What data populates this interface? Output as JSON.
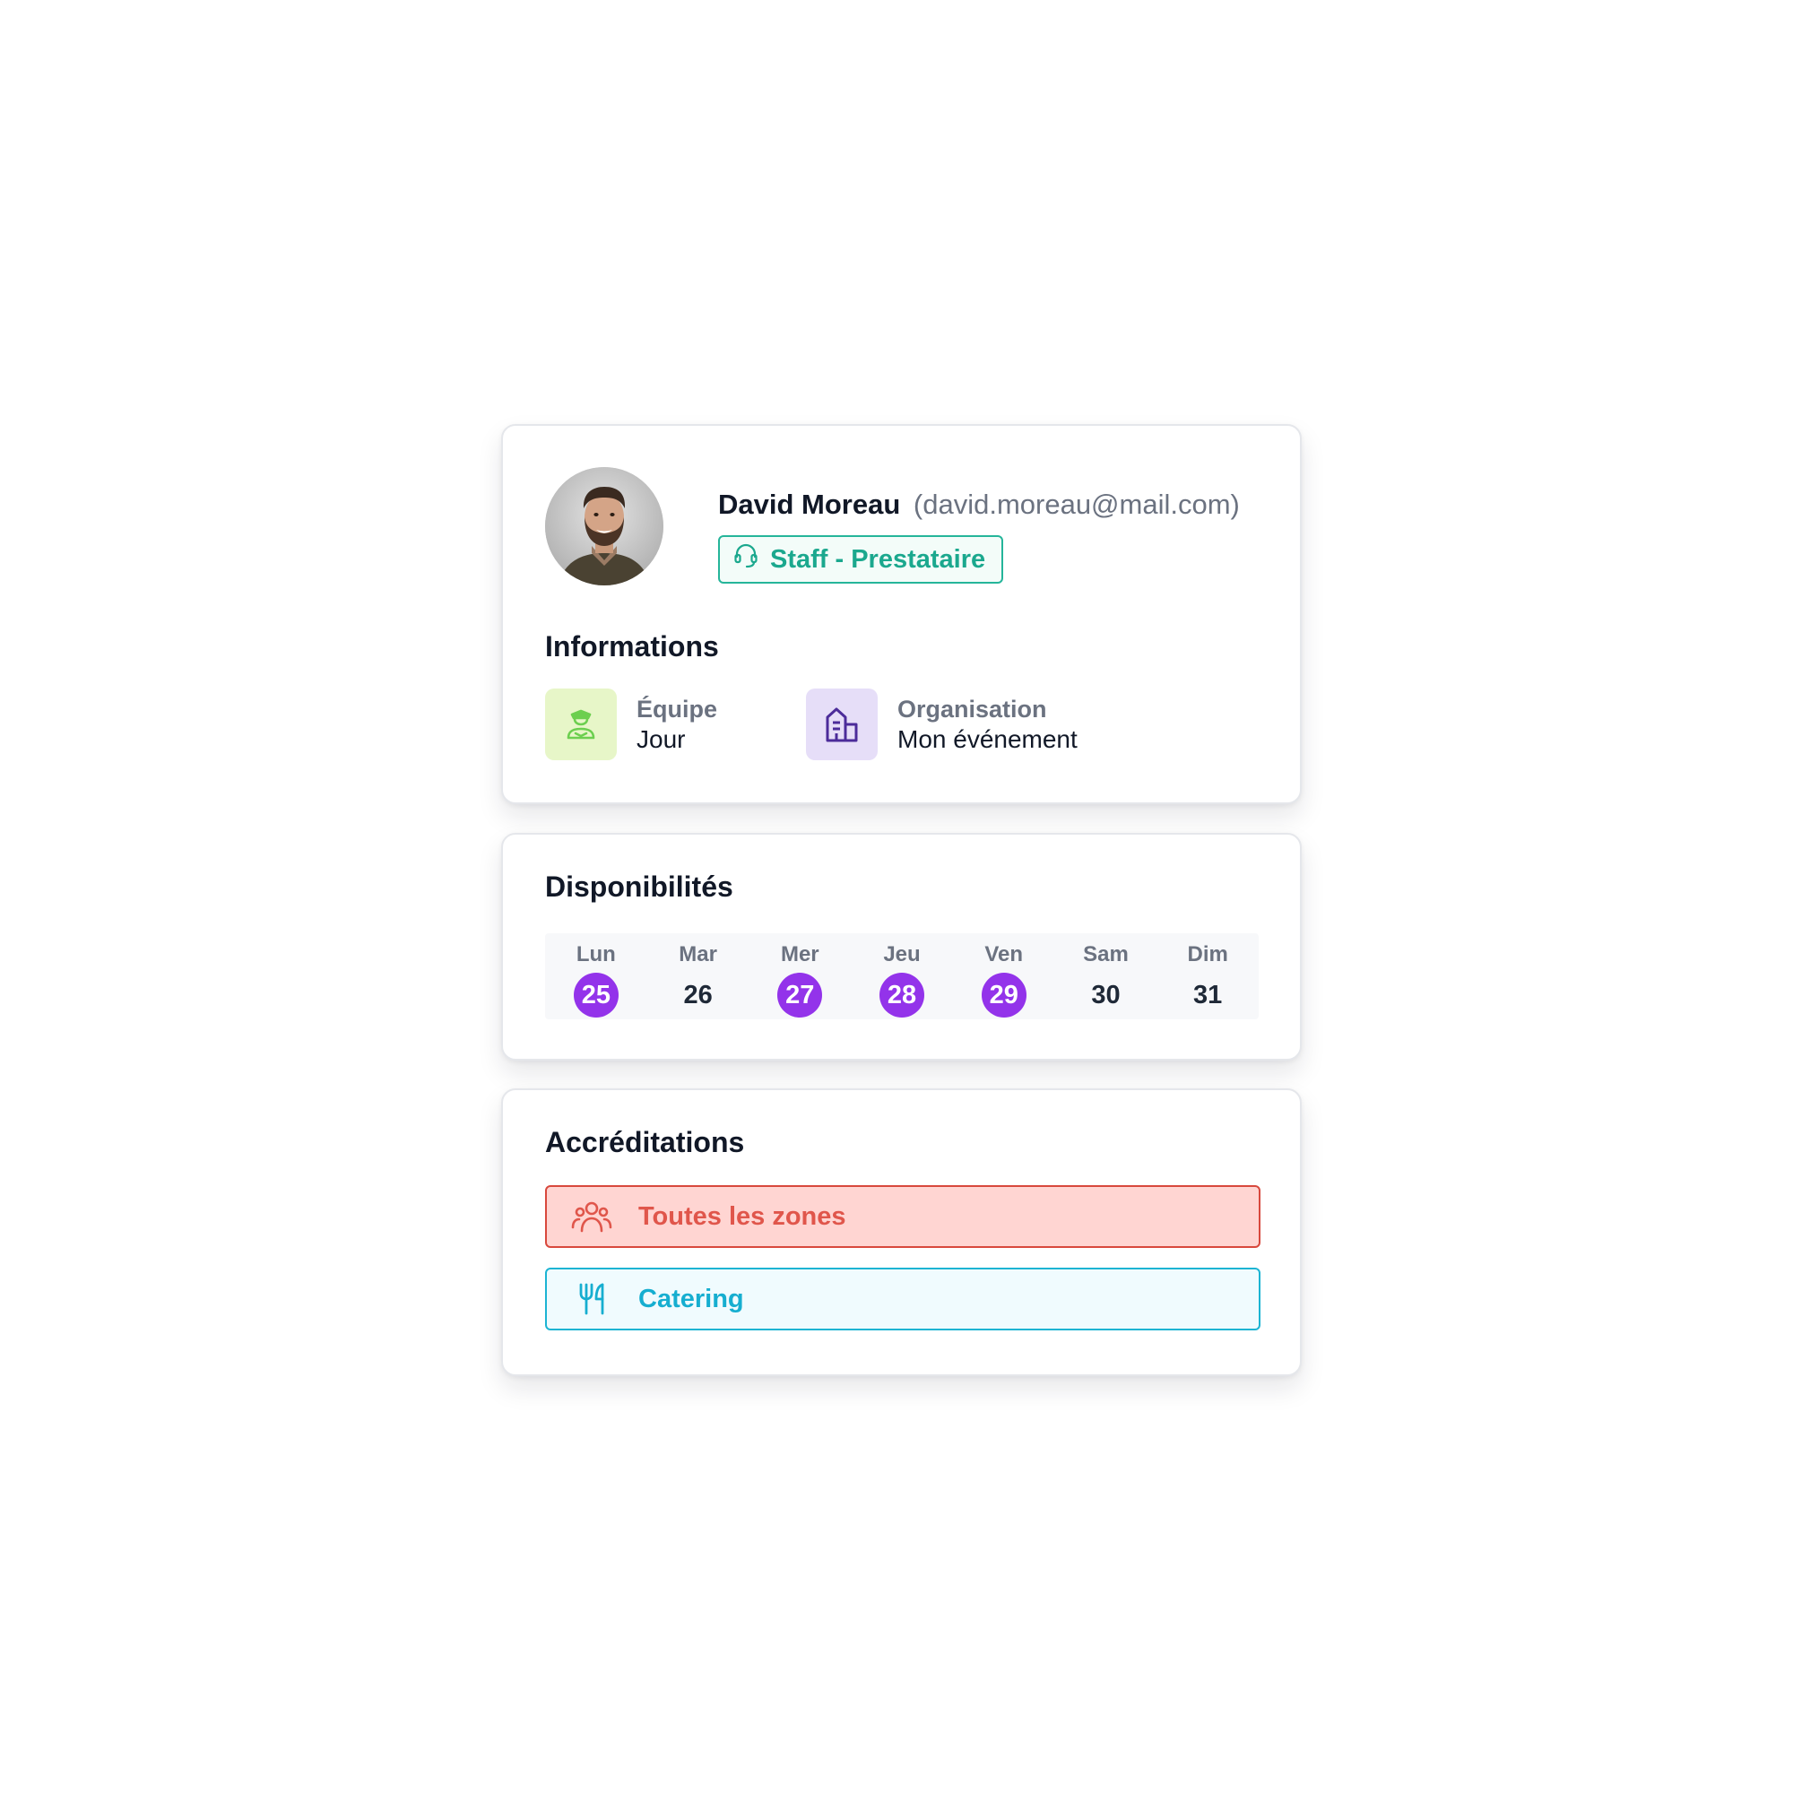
{
  "profile": {
    "name": "David Moreau",
    "email": "(david.moreau@mail.com)",
    "role": "Staff - Prestataire",
    "role_icon": "headset-icon",
    "colors": {
      "role": "#1ba88e"
    }
  },
  "informations": {
    "title": "Informations",
    "items": [
      {
        "label": "Équipe",
        "value": "Jour",
        "icon": "staff-person-icon",
        "icon_bg": "#e7f6c8",
        "icon_color": "#6ccf4f"
      },
      {
        "label": "Organisation",
        "value": "Mon événement",
        "icon": "building-icon",
        "icon_bg": "#e6def8",
        "icon_color": "#4c2c9a"
      }
    ]
  },
  "disponibilites": {
    "title": "Disponibilités",
    "days": [
      {
        "name": "Lun",
        "num": "25",
        "available": true
      },
      {
        "name": "Mar",
        "num": "26",
        "available": false
      },
      {
        "name": "Mer",
        "num": "27",
        "available": true
      },
      {
        "name": "Jeu",
        "num": "28",
        "available": true
      },
      {
        "name": "Ven",
        "num": "29",
        "available": true
      },
      {
        "name": "Sam",
        "num": "30",
        "available": false
      },
      {
        "name": "Dim",
        "num": "31",
        "available": false
      }
    ],
    "accent": "#9333ea"
  },
  "accreditations": {
    "title": "Accréditations",
    "items": [
      {
        "label": "Toutes les zones",
        "icon": "group-icon",
        "color": "#e0564b"
      },
      {
        "label": "Catering",
        "icon": "fork-knife-icon",
        "color": "#16aed0"
      }
    ]
  }
}
